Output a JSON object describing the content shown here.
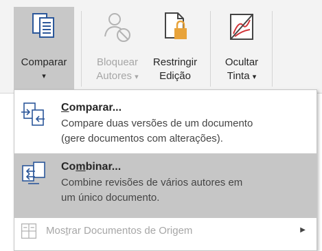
{
  "ribbon": {
    "comparar": {
      "label": "Comparar",
      "arrow": "▾"
    },
    "bloquear": {
      "label1": "Bloquear",
      "label2": "Autores",
      "arrow": "▾"
    },
    "restringir": {
      "label1": "Restringir",
      "label2": "Edição"
    },
    "ocultar": {
      "label1": "Ocultar",
      "label2": "Tinta",
      "arrow": "▾"
    }
  },
  "menu": {
    "items": [
      {
        "title_u": "C",
        "title_rest": "omparar...",
        "desc1": "Compare duas versões de um documento",
        "desc2": "(gere documentos com alterações)."
      },
      {
        "title_pre": "Co",
        "title_u": "m",
        "title_rest": "binar...",
        "desc1": "Combine revisões de vários autores em",
        "desc2": "um único documento."
      }
    ],
    "footer": {
      "pre": "Mos",
      "u": "t",
      "rest": "rar Documentos de Origem",
      "arrow": "▶"
    }
  },
  "colors": {
    "ribbon_bg": "#f3f3f3",
    "pressed": "#c8c8c8",
    "highlight": "#c6c6c6",
    "icon_blue": "#2b579a",
    "lock_gold": "#e8a33a",
    "ink_red": "#d13438"
  }
}
